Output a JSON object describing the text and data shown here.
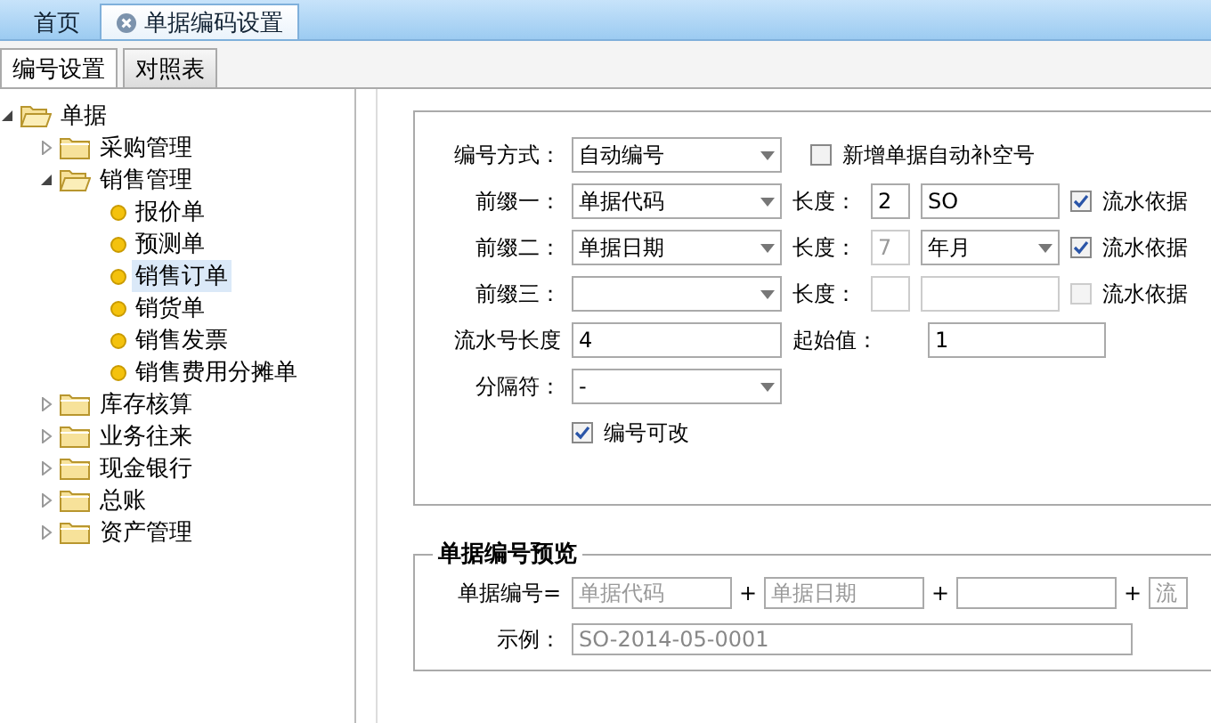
{
  "tabs": [
    {
      "label": "首页",
      "selected": false,
      "closable": false
    },
    {
      "label": "单据编码设置",
      "selected": true,
      "closable": true
    }
  ],
  "subtabs": [
    {
      "label": "编号设置",
      "selected": true
    },
    {
      "label": "对照表",
      "selected": false
    }
  ],
  "tree": [
    {
      "label": "单据",
      "expanded": true,
      "children": [
        {
          "label": "采购管理",
          "expanded": false
        },
        {
          "label": "销售管理",
          "expanded": true,
          "children": [
            {
              "label": "报价单",
              "selected": false
            },
            {
              "label": "预测单",
              "selected": false
            },
            {
              "label": "销售订单",
              "selected": true
            },
            {
              "label": "销货单",
              "selected": false
            },
            {
              "label": "销售发票",
              "selected": false
            },
            {
              "label": "销售费用分摊单",
              "selected": false
            }
          ]
        },
        {
          "label": "库存核算",
          "expanded": false
        },
        {
          "label": "业务往来",
          "expanded": false
        },
        {
          "label": "现金银行",
          "expanded": false
        },
        {
          "label": "总账",
          "expanded": false
        },
        {
          "label": "资产管理",
          "expanded": false
        }
      ]
    }
  ],
  "form": {
    "numbering_mode": {
      "label": "编号方式：",
      "value": "自动编号"
    },
    "auto_fill": {
      "label": "新增单据自动补空号",
      "checked": false
    },
    "prefixes": [
      {
        "label": "前缀一：",
        "value": "单据代码",
        "length_label": "长度：",
        "length": "2",
        "disabled": false,
        "extra": {
          "kind": "text",
          "value": "SO"
        },
        "serial": {
          "label": "流水依据",
          "checked": true
        }
      },
      {
        "label": "前缀二：",
        "value": "单据日期",
        "length_label": "长度：",
        "length": "7",
        "disabled": false,
        "length_readonly": true,
        "extra": {
          "kind": "select",
          "value": "年月"
        },
        "serial": {
          "label": "流水依据",
          "checked": true
        }
      },
      {
        "label": "前缀三：",
        "length_label": "长度：",
        "disabled": true,
        "extra": {
          "kind": "text"
        },
        "serial": {
          "label": "流水依据",
          "checked": false
        }
      }
    ],
    "serial_length": {
      "label": "流水号长度",
      "value": "4"
    },
    "start": {
      "label": "起始值：",
      "value": "1"
    },
    "separator": {
      "label": "分隔符：",
      "value": "-"
    },
    "editable": {
      "label": "编号可改",
      "checked": true
    }
  },
  "preview": {
    "title": "单据编号预览",
    "formula_label": "单据编号=",
    "parts": [
      {
        "text": "单据代码"
      },
      {
        "plus": "+",
        "text": "单据日期"
      },
      {
        "plus": "+"
      },
      {
        "plus": "+",
        "text": "流",
        "narrow": true
      }
    ],
    "example_label": "示例：",
    "example": "SO-2014-05-0001"
  }
}
